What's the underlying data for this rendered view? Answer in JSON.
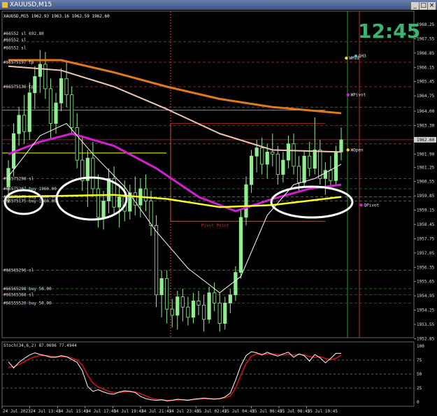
{
  "window": {
    "title": "XAUUSD,M15"
  },
  "header": {
    "symbol_info": "XAUUSD,M15  1962.93 1963.16 1962.59 1962.60",
    "clock": "12:45"
  },
  "colors": {
    "background": "#000000",
    "bull_candle": "#90ee90",
    "bear_candle": "#90ee90",
    "ma_orange": "#e07a1f",
    "ma_peach": "#f0c8b0",
    "ma_magenta": "#d020d0",
    "ma_white": "#ffffff",
    "ma_yellow": "#ffff20",
    "stoch_main": "#ffffff",
    "stoch_signal": "#c81414",
    "clock": "#3cb371"
  },
  "chart_data": [
    {
      "type": "candlestick",
      "title": "XAUUSD,M15",
      "ylim": [
        1952.9,
        1968.9
      ],
      "y_ticks": [
        "1968.25",
        "1967.55",
        "1966.85",
        "1966.15",
        "1965.45",
        "1964.75",
        "1964.00",
        "1963.30",
        "1962.60",
        "1961.90",
        "1961.25",
        "1960.55",
        "1959.85",
        "1959.15",
        "1958.45",
        "1957.75",
        "1957.05",
        "1956.35",
        "1955.65",
        "1954.95",
        "1954.25",
        "1953.55",
        "1952.85"
      ],
      "current_price": "1962.60",
      "x_ticks": [
        "24 Jul 2023",
        "24 Jul 13:45",
        "24 Jul 15:45",
        "24 Jul 17:45",
        "24 Jul 19:45",
        "24 Jul 21:45",
        "24 Jul 23:45",
        "25 Jul 02:45",
        "25 Jul 04:45",
        "25 Jul 06:45",
        "25 Jul 08:45",
        "25 Jul 10:45"
      ],
      "candles": [
        [
          1960.3,
          1961.6,
          1959.5,
          1961.2
        ],
        [
          1961.2,
          1963.4,
          1960.8,
          1962.9
        ],
        [
          1962.9,
          1964.2,
          1962.3,
          1963.8
        ],
        [
          1963.8,
          1964.8,
          1962.4,
          1963.0
        ],
        [
          1963.0,
          1965.4,
          1962.6,
          1964.9
        ],
        [
          1964.9,
          1966.2,
          1964.1,
          1965.7
        ],
        [
          1965.7,
          1967.0,
          1964.9,
          1966.3
        ],
        [
          1966.3,
          1966.9,
          1964.6,
          1965.1
        ],
        [
          1965.1,
          1965.6,
          1962.6,
          1963.4
        ],
        [
          1963.4,
          1964.9,
          1962.9,
          1964.4
        ],
        [
          1964.4,
          1966.1,
          1964.0,
          1965.6
        ],
        [
          1965.6,
          1966.4,
          1964.2,
          1964.8
        ],
        [
          1964.8,
          1965.2,
          1962.9,
          1963.2
        ],
        [
          1963.2,
          1963.9,
          1961.2,
          1961.6
        ],
        [
          1961.6,
          1962.8,
          1960.1,
          1960.6
        ],
        [
          1960.6,
          1962.1,
          1959.3,
          1961.7
        ],
        [
          1961.7,
          1962.5,
          1959.8,
          1960.2
        ],
        [
          1960.2,
          1960.9,
          1958.3,
          1958.8
        ],
        [
          1958.8,
          1960.1,
          1958.2,
          1959.6
        ],
        [
          1959.6,
          1961.2,
          1959.0,
          1960.7
        ],
        [
          1960.7,
          1961.3,
          1958.9,
          1959.3
        ],
        [
          1959.3,
          1960.3,
          1958.3,
          1959.8
        ],
        [
          1959.8,
          1960.6,
          1958.6,
          1959.1
        ],
        [
          1959.1,
          1960.4,
          1958.7,
          1960.0
        ],
        [
          1960.0,
          1960.8,
          1958.9,
          1959.4
        ],
        [
          1959.4,
          1960.7,
          1958.8,
          1960.2
        ],
        [
          1960.2,
          1960.9,
          1959.1,
          1959.6
        ],
        [
          1959.6,
          1960.1,
          1957.9,
          1958.4
        ],
        [
          1958.4,
          1958.9,
          1954.4,
          1955.0
        ],
        [
          1955.0,
          1956.2,
          1953.9,
          1955.8
        ],
        [
          1955.8,
          1956.2,
          1953.6,
          1954.3
        ],
        [
          1954.3,
          1954.8,
          1953.4,
          1954.0
        ],
        [
          1954.0,
          1955.2,
          1953.3,
          1954.9
        ],
        [
          1954.9,
          1955.3,
          1953.7,
          1954.4
        ],
        [
          1954.4,
          1954.9,
          1953.5,
          1953.9
        ],
        [
          1953.9,
          1955.1,
          1953.6,
          1954.7
        ],
        [
          1954.7,
          1955.2,
          1954.0,
          1954.5
        ],
        [
          1954.5,
          1955.0,
          1953.2,
          1953.8
        ],
        [
          1953.8,
          1955.4,
          1953.6,
          1955.1
        ],
        [
          1955.1,
          1955.6,
          1954.2,
          1954.6
        ],
        [
          1954.6,
          1955.1,
          1953.2,
          1953.6
        ],
        [
          1953.6,
          1954.9,
          1953.3,
          1954.6
        ],
        [
          1954.6,
          1955.3,
          1954.1,
          1955.0
        ],
        [
          1955.0,
          1956.4,
          1954.7,
          1956.1
        ],
        [
          1956.1,
          1959.2,
          1955.8,
          1958.8
        ],
        [
          1958.8,
          1960.8,
          1958.4,
          1960.4
        ],
        [
          1960.4,
          1962.1,
          1960.0,
          1961.8
        ],
        [
          1961.8,
          1962.6,
          1961.0,
          1962.2
        ],
        [
          1962.2,
          1962.7,
          1960.9,
          1961.4
        ],
        [
          1961.4,
          1962.4,
          1960.7,
          1962.0
        ],
        [
          1962.0,
          1962.9,
          1961.3,
          1961.9
        ],
        [
          1961.9,
          1962.3,
          1960.4,
          1960.9
        ],
        [
          1960.9,
          1962.0,
          1960.5,
          1961.6
        ],
        [
          1961.6,
          1962.8,
          1961.2,
          1962.4
        ],
        [
          1962.4,
          1962.9,
          1960.9,
          1961.3
        ],
        [
          1961.3,
          1961.8,
          1960.1,
          1960.5
        ],
        [
          1960.5,
          1962.1,
          1960.3,
          1961.8
        ],
        [
          1961.8,
          1962.5,
          1960.8,
          1961.2
        ],
        [
          1961.2,
          1963.7,
          1960.9,
          1962.1
        ],
        [
          1962.1,
          1962.6,
          1960.4,
          1960.7
        ],
        [
          1960.7,
          1961.5,
          1959.9,
          1961.1
        ],
        [
          1961.1,
          1961.8,
          1960.2,
          1960.6
        ],
        [
          1960.6,
          1962.3,
          1960.4,
          1962.0
        ],
        [
          1962.0,
          1963.2,
          1961.6,
          1962.6
        ]
      ],
      "lines": [
        {
          "name": "ma_orange",
          "points": [
            [
              0,
              1966.5
            ],
            [
              10,
              1966.5
            ],
            [
              20,
              1965.9
            ],
            [
              30,
              1965.2
            ],
            [
              40,
              1964.6
            ],
            [
              50,
              1964.2
            ],
            [
              63,
              1963.9
            ]
          ]
        },
        {
          "name": "ma_peach",
          "points": [
            [
              0,
              1966.2
            ],
            [
              10,
              1966.0
            ],
            [
              20,
              1965.2
            ],
            [
              30,
              1964.1
            ],
            [
              40,
              1962.9
            ],
            [
              50,
              1962.1
            ],
            [
              63,
              1962.0
            ]
          ]
        },
        {
          "name": "ma_magenta",
          "points": [
            [
              0,
              1961.9
            ],
            [
              6,
              1962.5
            ],
            [
              12,
              1962.9
            ],
            [
              20,
              1962.3
            ],
            [
              28,
              1961.2
            ],
            [
              36,
              1959.8
            ],
            [
              43,
              1959.1
            ],
            [
              50,
              1959.7
            ],
            [
              57,
              1960.2
            ],
            [
              63,
              1960.4
            ]
          ]
        },
        {
          "name": "ma_white",
          "points": [
            [
              0,
              1960.8
            ],
            [
              6,
              1962.8
            ],
            [
              11,
              1963.4
            ],
            [
              16,
              1961.9
            ],
            [
              22,
              1960.3
            ],
            [
              28,
              1958.1
            ],
            [
              34,
              1956.3
            ],
            [
              40,
              1955.1
            ],
            [
              44,
              1955.9
            ],
            [
              49,
              1958.9
            ],
            [
              54,
              1960.4
            ],
            [
              58,
              1960.7
            ],
            [
              63,
              1961.4
            ]
          ]
        },
        {
          "name": "ma_yellow",
          "points": [
            [
              0,
              1959.8
            ],
            [
              20,
              1959.9
            ],
            [
              30,
              1959.7
            ],
            [
              40,
              1959.3
            ],
            [
              50,
              1959.4
            ],
            [
              63,
              1959.8
            ]
          ]
        }
      ],
      "annotations": {
        "labels": [
          {
            "text": "Pivot Point",
            "x": 36.5,
            "y": 1958.4,
            "color": "#c03030"
          },
          {
            "text": "WMid",
            "x": 64.5,
            "y": 1966.6,
            "color": "#e8e8e8"
          },
          {
            "text": "QH3",
            "x": 66.3,
            "y": 1966.7,
            "color": "#e8e8e8"
          },
          {
            "text": "WPivot",
            "x": 64.8,
            "y": 1964.8,
            "color": "#e8e8e8"
          },
          {
            "text": "WOpen",
            "x": 64.8,
            "y": 1962.1,
            "color": "#e8e8e8"
          },
          {
            "text": "QPivot",
            "x": 67.3,
            "y": 1959.4,
            "color": "#e8e8e8"
          }
        ],
        "order_labels": [
          {
            "text": "#66552 sl 692.80",
            "y": 1967.8
          },
          {
            "text": "#66552 sl",
            "y": 1967.5
          },
          {
            "text": "#66552 sl",
            "y": 1967.1
          },
          {
            "text": "#66575197 tp",
            "y": 1966.4
          },
          {
            "text": "#66575136 tp",
            "y": 1965.2
          },
          {
            "text": "#66575298 sl",
            "y": 1960.7
          },
          {
            "text": "#66575207 buy 1960.00",
            "y": 1960.2
          },
          {
            "text": "#66575175 buy 1960.00",
            "y": 1959.8
          },
          {
            "text": "#66575175 buy 1960.00",
            "y": 1959.6
          },
          {
            "text": "#66565296 sl",
            "y": 1956.2
          },
          {
            "text": "#66565298 buy 50.00",
            "y": 1955.3
          },
          {
            "text": "#66565368 sl",
            "y": 1955.0
          },
          {
            "text": "#66555520 buy 50.00",
            "y": 1954.6
          }
        ]
      }
    },
    {
      "type": "line",
      "title": "Stoch(34,6,2) 87.0696 77.4944",
      "ylim": [
        0,
        100
      ],
      "y_ticks": [
        "100",
        "75",
        "50",
        "25",
        "0"
      ],
      "series": [
        {
          "name": "main",
          "values": [
            72,
            61,
            71,
            78,
            84,
            88,
            85,
            83,
            80,
            80,
            83,
            81,
            76,
            71,
            56,
            28,
            19,
            22,
            18,
            15,
            14,
            18,
            20,
            19,
            17,
            10,
            6,
            4,
            3,
            4,
            2,
            3,
            5,
            4,
            3,
            5,
            6,
            7,
            6,
            5,
            6,
            9,
            16,
            39,
            65,
            83,
            90,
            88,
            84,
            89,
            85,
            82,
            86,
            89,
            80,
            86,
            83,
            73,
            85,
            79,
            70,
            78,
            87,
            87
          ]
        },
        {
          "name": "signal",
          "values": [
            62,
            63,
            67,
            72,
            77,
            81,
            83,
            83,
            82,
            81,
            81,
            81,
            79,
            75,
            66,
            48,
            34,
            27,
            23,
            19,
            17,
            17,
            18,
            19,
            18,
            15,
            11,
            7,
            5,
            4,
            3,
            3,
            4,
            4,
            4,
            4,
            5,
            6,
            6,
            6,
            6,
            7,
            11,
            25,
            48,
            69,
            82,
            86,
            86,
            86,
            86,
            85,
            84,
            85,
            84,
            85,
            84,
            81,
            80,
            81,
            78,
            76,
            78,
            84
          ]
        }
      ]
    }
  ]
}
